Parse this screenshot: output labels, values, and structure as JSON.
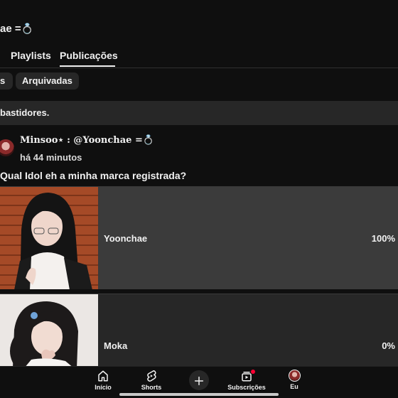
{
  "header": {
    "channel_title": "ae =",
    "channel_title_emoji": "💍"
  },
  "tabs": [
    {
      "label": "Playlists",
      "active": false
    },
    {
      "label": "Publicações",
      "active": true
    }
  ],
  "chips": [
    {
      "label": "s"
    },
    {
      "label": "Arquivadas"
    }
  ],
  "banner": {
    "text": "bastidores."
  },
  "post": {
    "author": "Minsoo⋆ : @Yoonchae =",
    "author_emoji": "💍",
    "time": "há 44 minutos",
    "question": "Qual Idol eh a minha marca registrada?",
    "options": [
      {
        "label": "Yoonchae",
        "percent": "100%",
        "share": 1.0
      },
      {
        "label": "Moka",
        "percent": "0%",
        "share": 0.0
      }
    ]
  },
  "bottom_nav": {
    "home": "Início",
    "shorts": "Shorts",
    "create": "",
    "subscriptions": "Subscrições",
    "you": "Eu"
  },
  "colors": {
    "background": "#0f0f0f",
    "surface": "#272727",
    "selected_option": "#3b3b3b",
    "text": "#f1f1f1",
    "notification": "#ff0033"
  }
}
